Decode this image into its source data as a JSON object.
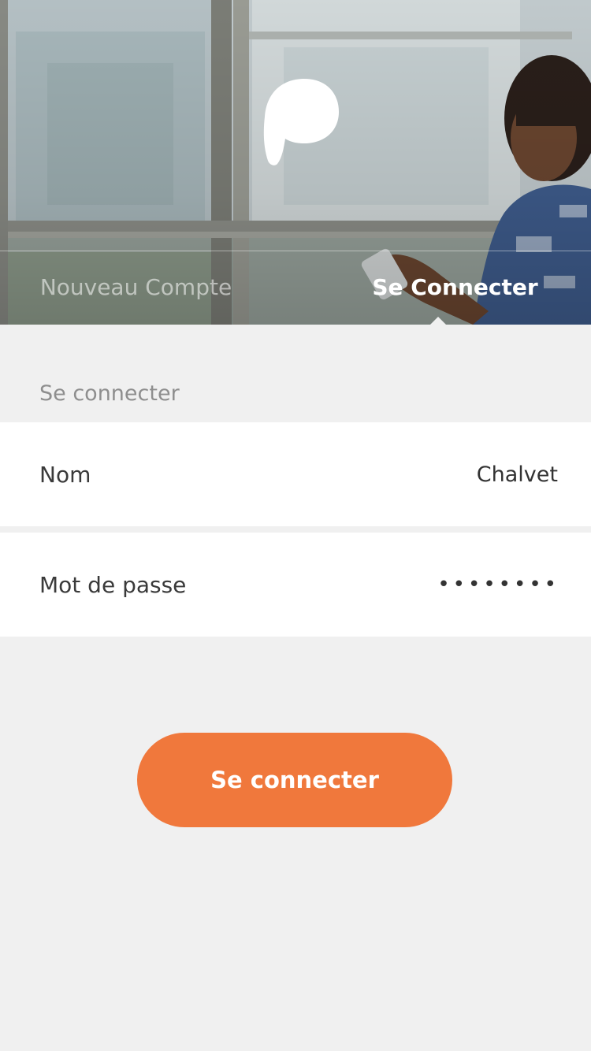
{
  "tabs": {
    "new_account": "Nouveau Compte",
    "login": "Se Connecter",
    "active": "login"
  },
  "form": {
    "section_title": "Se connecter",
    "name_label": "Nom",
    "name_value": "Chalvet",
    "password_label": "Mot de passe",
    "password_value": "••••••••"
  },
  "submit_label": "Se connecter",
  "icons": {
    "logo": "speech-bubble-logo-icon"
  },
  "colors": {
    "accent": "#f0783c",
    "background": "#f0f0f0",
    "field_background": "#ffffff",
    "muted_text": "#8e8e8e",
    "text": "#333333"
  }
}
